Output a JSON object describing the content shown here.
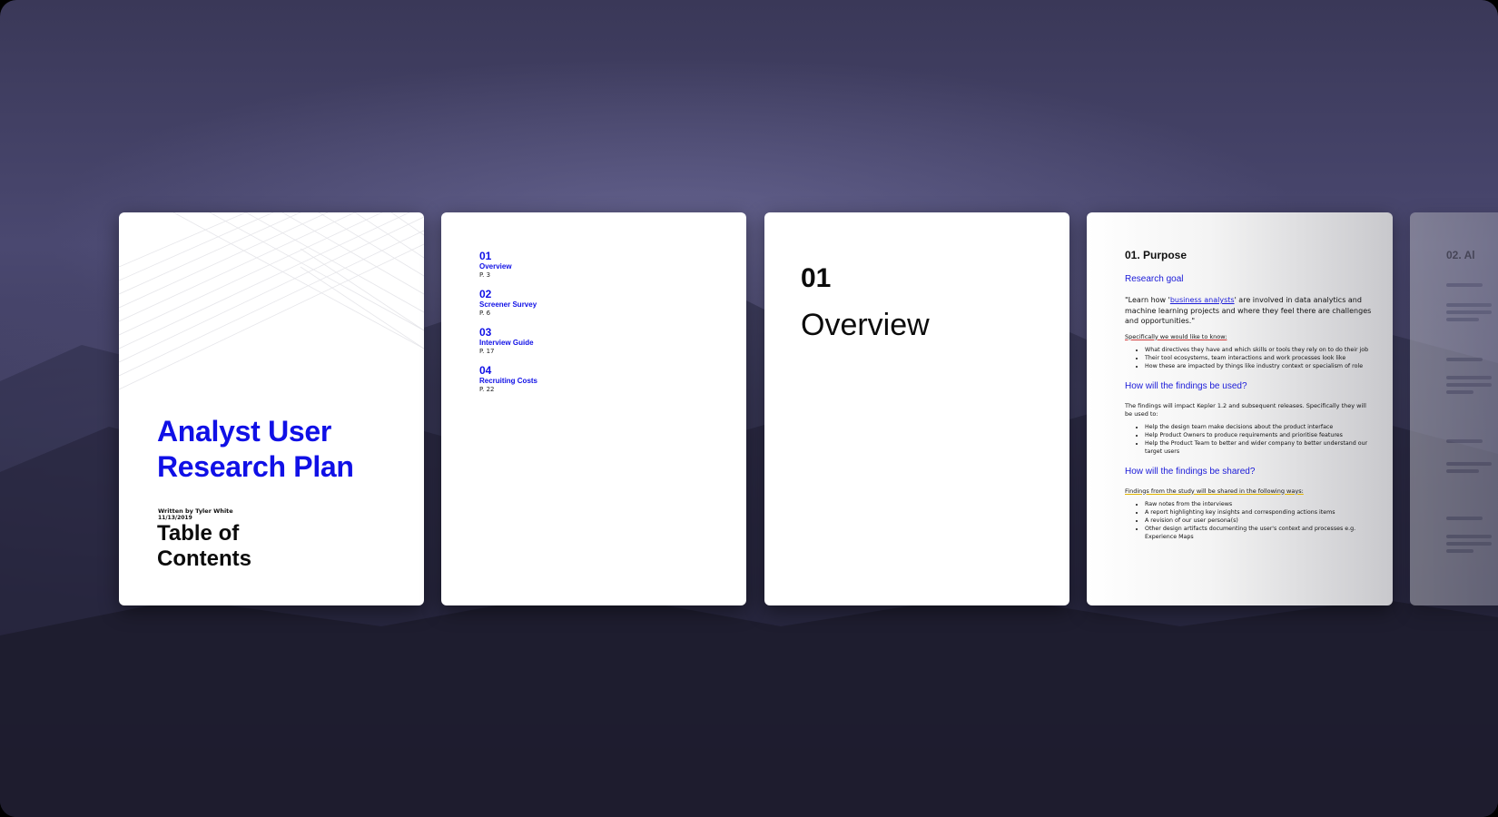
{
  "cover": {
    "title_line1": "Analyst User",
    "title_line2": "Research Plan",
    "author": "Written by Tyler White",
    "date": "11/13/2019",
    "toc_line1": "Table of",
    "toc_line2": "Contents"
  },
  "toc": {
    "entries": [
      {
        "num": "01",
        "label": "Overview",
        "page": "P. 3"
      },
      {
        "num": "02",
        "label": "Screener Survey",
        "page": "P. 6"
      },
      {
        "num": "03",
        "label": "Interview Guide",
        "page": "P. 17"
      },
      {
        "num": "04",
        "label": "Recruiting Costs",
        "page": "P. 22"
      }
    ]
  },
  "overview": {
    "num": "01",
    "title": "Overview"
  },
  "purpose": {
    "heading": "01. Purpose",
    "research_goal_heading": "Research goal",
    "quote_pre": "\"Learn how '",
    "quote_link": "business analysts",
    "quote_post": "' are involved in data analytics and machine learning projects and where they feel there are challenges and opportunities.\"",
    "specifically_intro": "Specifically we would like to know:",
    "know_items": [
      "What directives they have and which skills or tools they rely on to do their job",
      "Their tool ecosystems, team interactions and work processes look like",
      "How these are impacted by things like industry context or specialism of role"
    ],
    "used_heading": "How will the findings be used?",
    "used_intro": "The findings will impact Kepler 1.2 and subsequent releases. Specifically they will be used to:",
    "used_items": [
      "Help the design team make decisions about the product interface",
      "Help Product Owners to produce requirements and prioritise features",
      "Help the Product Team to better and wider company to better understand our target users"
    ],
    "shared_heading": "How will the findings be shared?",
    "shared_intro": "Findings from the study will be shared in the following ways:",
    "shared_items": [
      "Raw notes from the interviews",
      "A report highlighting key insights and corresponding actions items",
      "A revision of our user persona(s)",
      "Other design artifacts documenting the user's context and processes e.g. Experience Maps"
    ]
  },
  "next_page": {
    "heading": "02. Al"
  }
}
